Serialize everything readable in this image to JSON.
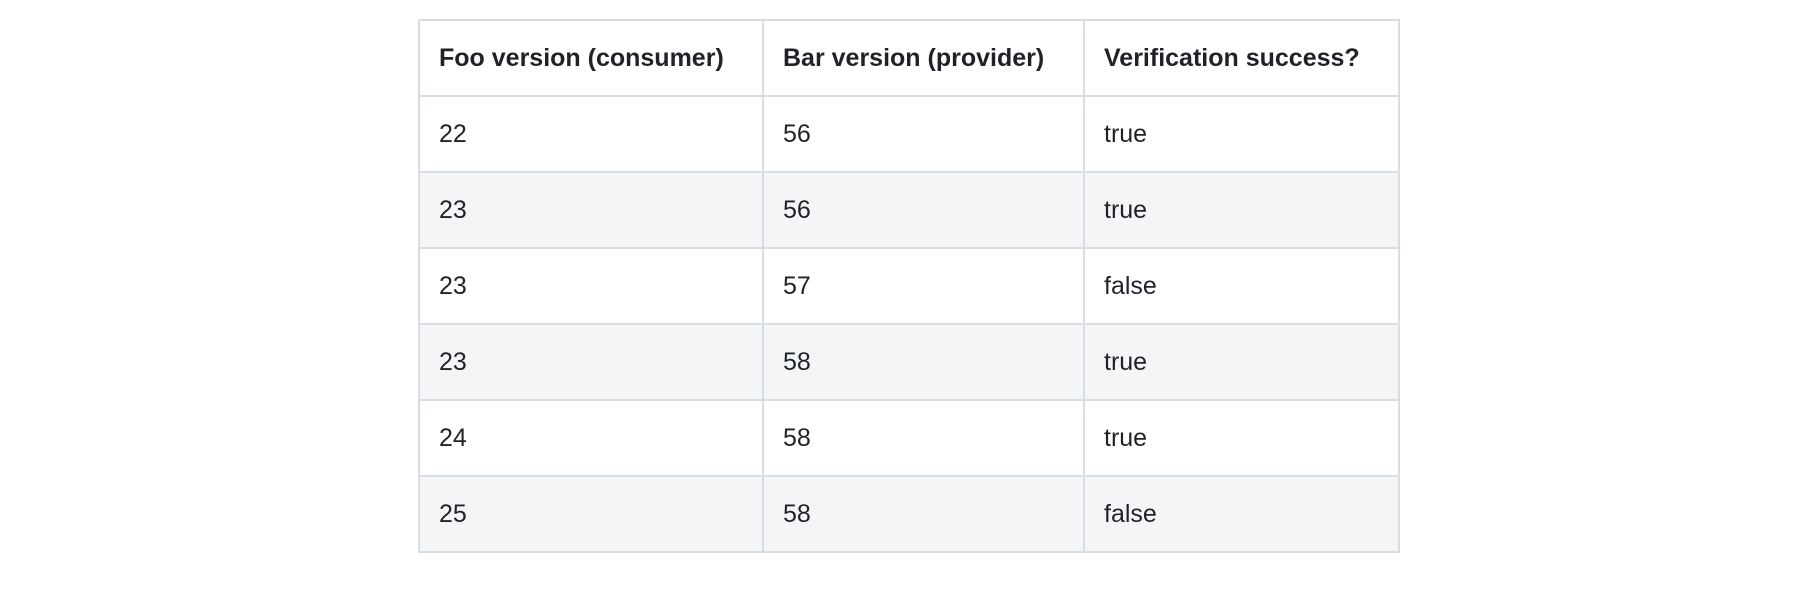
{
  "table": {
    "headers": [
      "Foo version (consumer)",
      "Bar version (provider)",
      "Verification success?"
    ],
    "rows": [
      [
        "22",
        "56",
        "true"
      ],
      [
        "23",
        "56",
        "true"
      ],
      [
        "23",
        "57",
        "false"
      ],
      [
        "23",
        "58",
        "true"
      ],
      [
        "24",
        "58",
        "true"
      ],
      [
        "25",
        "58",
        "false"
      ]
    ]
  }
}
